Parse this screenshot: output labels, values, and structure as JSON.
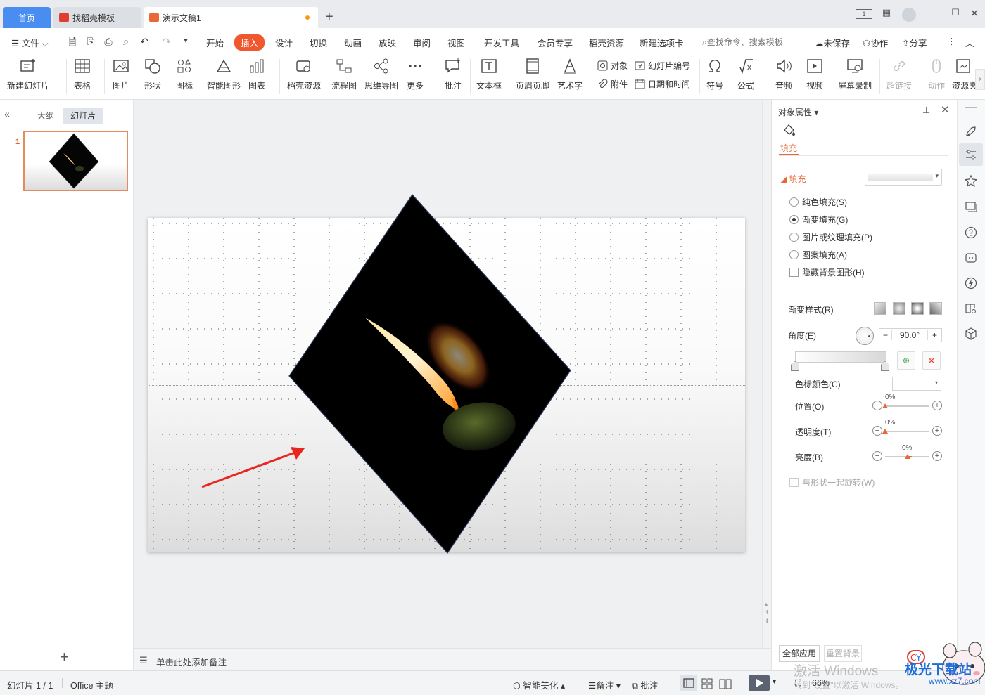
{
  "tabs": {
    "home": "首页",
    "templates": "找稻壳模板",
    "document": "演示文稿1",
    "new_tab": "+"
  },
  "menu": {
    "file": "文件",
    "items": [
      "开始",
      "插入",
      "设计",
      "切换",
      "动画",
      "放映",
      "审阅",
      "视图",
      "开发工具",
      "会员专享",
      "稻壳资源",
      "新建选项卡"
    ],
    "search_placeholder": "查找命令、搜索模板",
    "unsaved": "未保存",
    "collaborate": "协作",
    "share": "分享"
  },
  "ribbon": {
    "new_slide": "新建幻灯片",
    "table": "表格",
    "picture": "图片",
    "shape": "形状",
    "icon": "图标",
    "smart_graphic": "智能图形",
    "chart": "图表",
    "docer_resource": "稻壳资源",
    "flowchart": "流程图",
    "mindmap": "思维导图",
    "more": "更多",
    "comment": "批注",
    "textbox": "文本框",
    "header_footer": "页眉页脚",
    "wordart": "艺术字",
    "object": "对象",
    "slide_number": "幻灯片编号",
    "attachment": "附件",
    "date_time": "日期和时间",
    "symbol": "符号",
    "formula": "公式",
    "audio": "音频",
    "video": "视频",
    "screen_record": "屏幕录制",
    "hyperlink": "超链接",
    "action": "动作",
    "resource": "资源夹"
  },
  "left_panel": {
    "outline_tab": "大纲",
    "slides_tab": "幻灯片",
    "slide_number": "1"
  },
  "notes_placeholder": "单击此处添加备注",
  "right_panel": {
    "title": "对象属性",
    "fill_tab": "填充",
    "fill_section": "填充",
    "options": [
      {
        "label": "纯色填充(S)",
        "selected": false
      },
      {
        "label": "渐变填充(G)",
        "selected": true
      },
      {
        "label": "图片或纹理填充(P)",
        "selected": false
      },
      {
        "label": "图案填充(A)",
        "selected": false
      }
    ],
    "hide_background": "隐藏背景图形(H)",
    "gradient_style": "渐变样式(R)",
    "angle_label": "角度(E)",
    "angle_value": "90.0°",
    "stop_color": "色标颜色(C)",
    "position_label": "位置(O)",
    "position_value": "0%",
    "transparency_label": "透明度(T)",
    "transparency_value": "0%",
    "brightness_label": "亮度(B)",
    "brightness_value": "0%",
    "rotate_with_shape": "与形状一起旋转(W)",
    "apply_all": "全部应用",
    "reset_background": "重置背景"
  },
  "status": {
    "slide_pos": "幻灯片 1 / 1",
    "theme": "Office 主题",
    "beautify": "智能美化",
    "notes": "备注",
    "comments": "批注",
    "zoom": "66%"
  },
  "overlay": {
    "activate_windows": "激活 Windows",
    "activate_hint": "转到\"设置\"以激活 Windows。",
    "site_name": "极光下载站",
    "site_url": "www.xz7.com"
  },
  "colors": {
    "accent": "#e8683a",
    "home_tab": "#4a8df0",
    "insert_tab": "#f0572e",
    "arrow": "#e8261f"
  }
}
